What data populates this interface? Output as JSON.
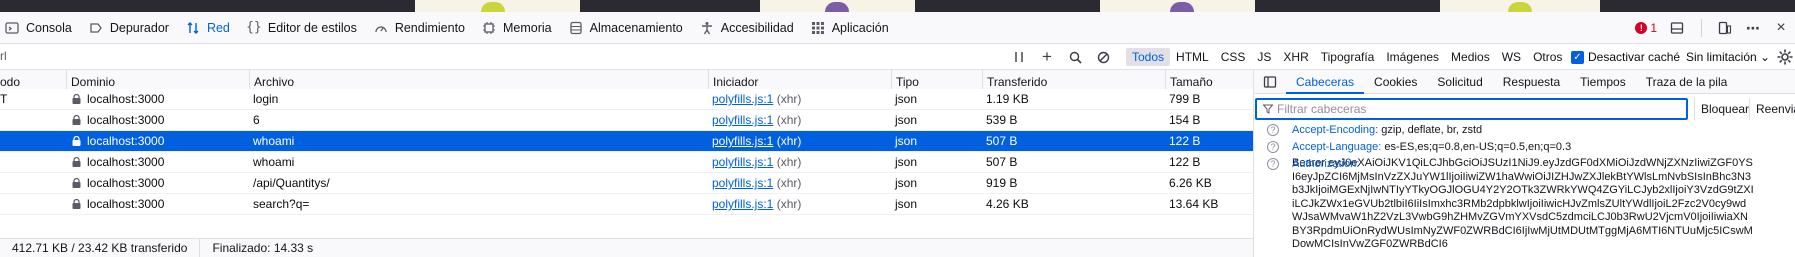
{
  "toolbar": {
    "tabs": [
      {
        "label": "Consola",
        "icon": "console-icon"
      },
      {
        "label": "Depurador",
        "icon": "debugger-icon"
      },
      {
        "label": "Red",
        "icon": "network-icon"
      },
      {
        "label": "Editor de estilos",
        "icon": "style-editor-icon"
      },
      {
        "label": "Rendimiento",
        "icon": "performance-icon"
      },
      {
        "label": "Memoria",
        "icon": "memory-icon"
      },
      {
        "label": "Almacenamiento",
        "icon": "storage-icon"
      },
      {
        "label": "Accesibilidad",
        "icon": "accessibility-icon"
      },
      {
        "label": "Aplicación",
        "icon": "application-icon"
      }
    ],
    "selected": "Red",
    "error_count": "1"
  },
  "filter": {
    "url_placeholder_fragment": "rl",
    "types": [
      "Todos",
      "HTML",
      "CSS",
      "JS",
      "XHR",
      "Tipografía",
      "Imágenes",
      "Medios",
      "WS",
      "Otros"
    ],
    "selected_type": "Todos",
    "disable_cache_label": "Desactivar caché",
    "throttling_label": "Sin limitación ⌄"
  },
  "table": {
    "columns": [
      "odo",
      "Dominio",
      "Archivo",
      "Iniciador",
      "Tipo",
      "Transferido",
      "Tamaño"
    ],
    "rows": [
      {
        "method": "T",
        "domain": "localhost:3000",
        "file": "login",
        "initiator": "polyfills.js:1",
        "cause": "(xhr)",
        "type": "json",
        "transferred": "1.19 KB",
        "size": "799 B"
      },
      {
        "method": "",
        "domain": "localhost:3000",
        "file": "6",
        "initiator": "polyfills.js:1",
        "cause": "(xhr)",
        "type": "json",
        "transferred": "539 B",
        "size": "154 B"
      },
      {
        "method": "",
        "domain": "localhost:3000",
        "file": "whoami",
        "initiator": "polyfills.js:1",
        "cause": "(xhr)",
        "type": "json",
        "transferred": "507 B",
        "size": "122 B"
      },
      {
        "method": "",
        "domain": "localhost:3000",
        "file": "whoami",
        "initiator": "polyfills.js:1",
        "cause": "(xhr)",
        "type": "json",
        "transferred": "507 B",
        "size": "122 B"
      },
      {
        "method": "",
        "domain": "localhost:3000",
        "file": "/api/Quantitys/",
        "initiator": "polyfills.js:1",
        "cause": "(xhr)",
        "type": "json",
        "transferred": "919 B",
        "size": "6.26 KB"
      },
      {
        "method": "",
        "domain": "localhost:3000",
        "file": "search?q=",
        "initiator": "polyfills.js:1",
        "cause": "(xhr)",
        "type": "json",
        "transferred": "4.26 KB",
        "size": "13.64 KB"
      }
    ],
    "selected_row": 2
  },
  "status": {
    "transfer": "412.71 KB / 23.42 KB transferido",
    "finished": "Finalizado: 14.33 s"
  },
  "sidebar": {
    "tabs": [
      "Cabeceras",
      "Cookies",
      "Solicitud",
      "Respuesta",
      "Tiempos",
      "Traza de la pila"
    ],
    "selected": "Cabeceras",
    "filter_placeholder": "Filtrar cabeceras",
    "block_label": "Bloquear",
    "resend_label": "Reenviar",
    "headers": [
      {
        "name": "Accept-Encoding:",
        "value": "gzip, deflate, br, zstd"
      },
      {
        "name": "Accept-Language:",
        "value": "es-ES,es;q=0.8,en-US;q=0.5,en;q=0.3"
      },
      {
        "name": "Authorization:",
        "value": "Bearer eyJ0eXAiOiJKV1QiLCJhbGciOiJSUzI1NiJ9.eyJzdGF0dXMiOiJzdWNjZXNzIiwiZGF0YSI6eyJpZCI6MjMsInVzZXJuYW1lIjoiIiwiZW1haWwiOiJIZHJwZXJlekBtYWlsLmNvbSIsInBhc3N3b3JkIjoiMGExNjIwNTIyYTkyOGJlOGU4Y2Y2OTk3ZWRkYWQ4ZGYiLCJyb2xlIjoiY3VzdG9tZXIiLCJkZWx1eGVUb2tlbiI6IiIsImxhc3RMb2dpbklwIjoiIiwicHJvZmlsZUltYWdlIjoiL2Fzc2V0cy9wdWJsaWMvaW1hZ2VzL3VwbG9hZHMvZGVmYXVsdC5zdmciLCJ0b3RwU2VjcmV0IjoiIiwiaXNBY3RpdmUiOnRydWUsImNyZWF0ZWRBdCI6IjIwMjUtMDUtMTggMjA6MTI6NTUuMjc5ICswMDowMCIsInVwZGF0ZWRBdCI6"
      }
    ]
  }
}
